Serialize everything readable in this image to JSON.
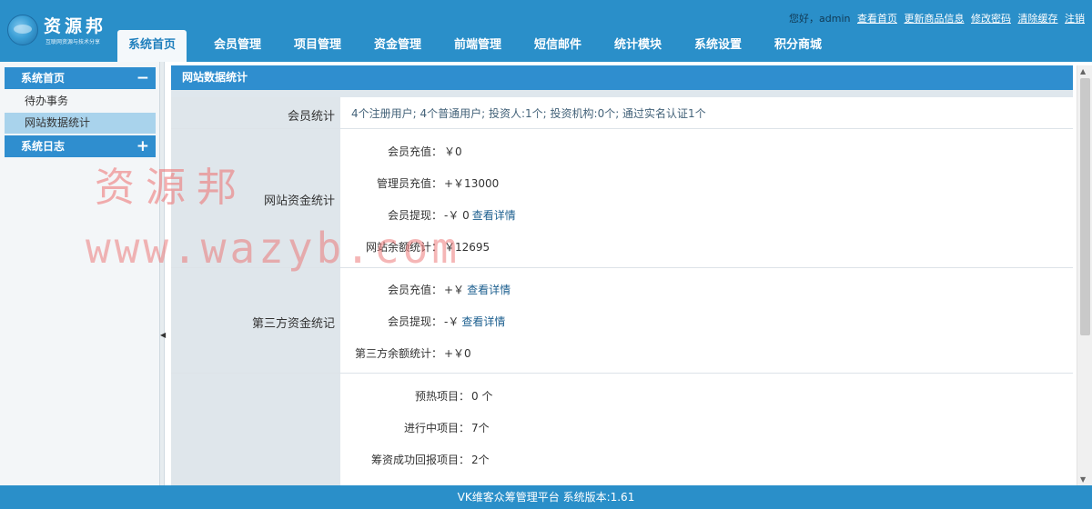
{
  "header": {
    "logo_name": "资源邦",
    "logo_subtitle": "互联网资源与技术分享",
    "greeting": "您好，admin",
    "links": [
      "查看首页",
      "更新商品信息",
      "修改密码",
      "清除缓存",
      "注销"
    ]
  },
  "nav": [
    "系统首页",
    "会员管理",
    "项目管理",
    "资金管理",
    "前端管理",
    "短信邮件",
    "统计模块",
    "系统设置",
    "积分商城"
  ],
  "sidebar": {
    "group1": {
      "title": "系统首页",
      "sign": "−"
    },
    "items": [
      "待办事务",
      "网站数据统计"
    ],
    "group2": {
      "title": "系统日志",
      "sign": "+"
    }
  },
  "panel": {
    "title": "网站数据统计"
  },
  "stats": {
    "members": {
      "label": "会员统计",
      "text": "4个注册用户;  4个普通用户;  投资人:1个;  投资机构:0个;  通过实名认证1个"
    },
    "site_funds": {
      "label": "网站资金统计",
      "recharge_k": "会员充值：",
      "recharge_v": "￥0",
      "admin_recharge_k": "管理员充值：",
      "admin_recharge_v": "+￥13000",
      "withdraw_k": "会员提现：",
      "withdraw_v": "-￥ 0",
      "withdraw_link": "查看详情",
      "balance_k": "网站余额统计：",
      "balance_v": "￥12695"
    },
    "third_party": {
      "label": "第三方资金统记",
      "recharge_k": "会员充值：",
      "recharge_v": "+￥",
      "recharge_link": "查看详情",
      "withdraw_k": "会员提现：",
      "withdraw_v": "-￥",
      "withdraw_link": "查看详情",
      "balance_k": "第三方余额统计：",
      "balance_v": "+￥0"
    },
    "projects": {
      "preheat_k": "预热项目：",
      "preheat_v": "0 个",
      "ongoing_k": "进行中项目：",
      "ongoing_v": "7个",
      "success_k": "筹资成功回报项目：",
      "success_v": "2个"
    }
  },
  "footer": {
    "text": "VK维客众筹管理平台 系统版本:1.61"
  },
  "watermark": {
    "line1": "资源邦",
    "line2": "www.wazyb.com"
  }
}
